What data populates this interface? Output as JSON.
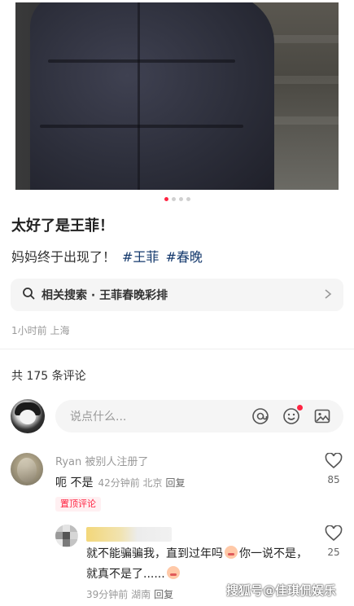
{
  "post": {
    "carousel": {
      "total": 4,
      "current": 1
    },
    "title": "太好了是王菲！",
    "description": "妈妈终于出现了！",
    "tags": [
      "#王菲",
      "#春晚"
    ],
    "related_search": "相关搜索 · 王菲春晚彩排",
    "meta": "1小时前 上海"
  },
  "comments_header": {
    "count_text": "共 175 条评论"
  },
  "comment_input": {
    "placeholder": "说点什么..."
  },
  "icons": {
    "search": "search-icon",
    "mention": "at-icon",
    "emoji": "emoji-icon",
    "image": "image-icon",
    "like": "heart-icon",
    "chevron": "chevron-right-icon"
  },
  "colors": {
    "accent": "#ff2442",
    "tag": "#13386c"
  },
  "comments": [
    {
      "author": "Ryan 被别人注册了",
      "text": "呃 不是",
      "time_location": "42分钟前 北京",
      "reply_label": "回复",
      "likes": "85",
      "badge": "置顶评论",
      "replies": [
        {
          "text_part1": "就不能骗骗我，直到过年吗",
          "text_part2": "你一说不是，就真不是了......",
          "time_location": "39分钟前 湖南",
          "reply_label": "回复",
          "likes": "25"
        }
      ]
    }
  ],
  "watermark": "搜狐号@佳琪侃娱乐"
}
